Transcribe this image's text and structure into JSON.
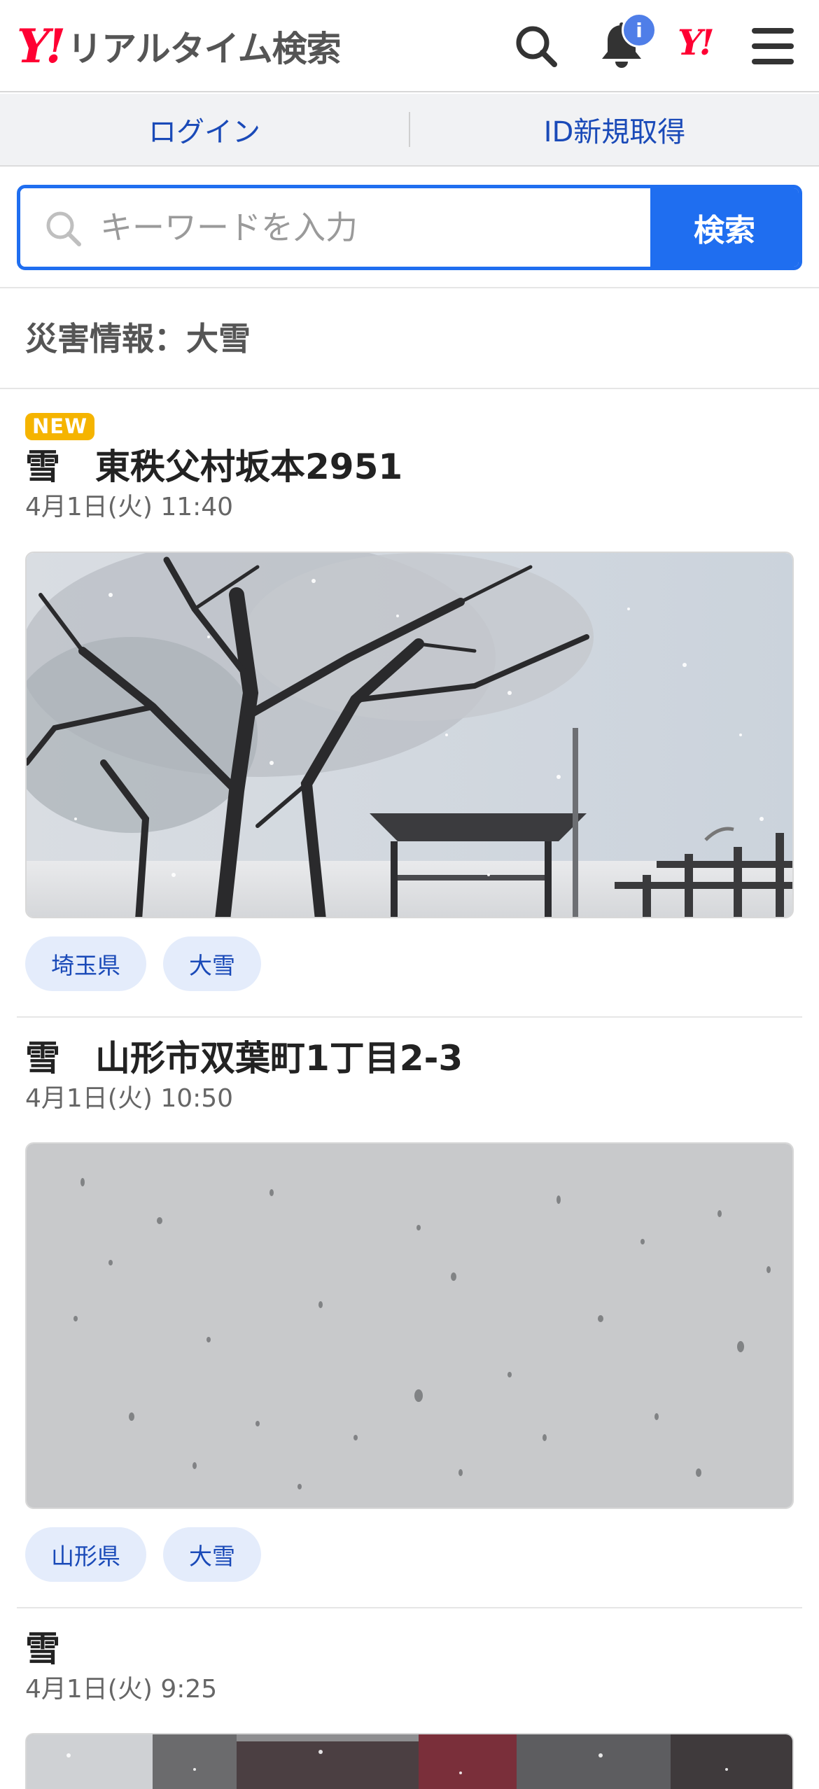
{
  "header": {
    "logo_mark": "Y!",
    "logo_text": "リアルタイム検索",
    "notification_badge": "i",
    "yahoo_mini_logo": "Y!",
    "icons": [
      "search-icon",
      "bell-icon",
      "yahoo-logo-icon",
      "menu-icon"
    ]
  },
  "account": {
    "login": "ログイン",
    "signup": "ID新規取得"
  },
  "search": {
    "placeholder": "キーワードを入力",
    "button": "検索"
  },
  "section": {
    "title": "災害情報：大雪"
  },
  "posts": [
    {
      "badge": "NEW",
      "title": "雪　東秩父村坂本2951",
      "date": "4月1日(火) 11:40",
      "image": "snowy-trees-shelter-photo",
      "tags": [
        "埼玉県",
        "大雪"
      ]
    },
    {
      "title": "雪　山形市双葉町1丁目2-3",
      "date": "4月1日(火) 10:50",
      "image": "falling-snow-photo",
      "tags": [
        "山形県",
        "大雪"
      ]
    },
    {
      "title": "雪",
      "date": "4月1日(火) 9:25",
      "image": "snowy-street-photo"
    }
  ],
  "colors": {
    "brand_red": "#ff0033",
    "accent_blue": "#1f6ef0",
    "link_blue": "#1a4ab8",
    "badge_yellow": "#f5b400"
  }
}
